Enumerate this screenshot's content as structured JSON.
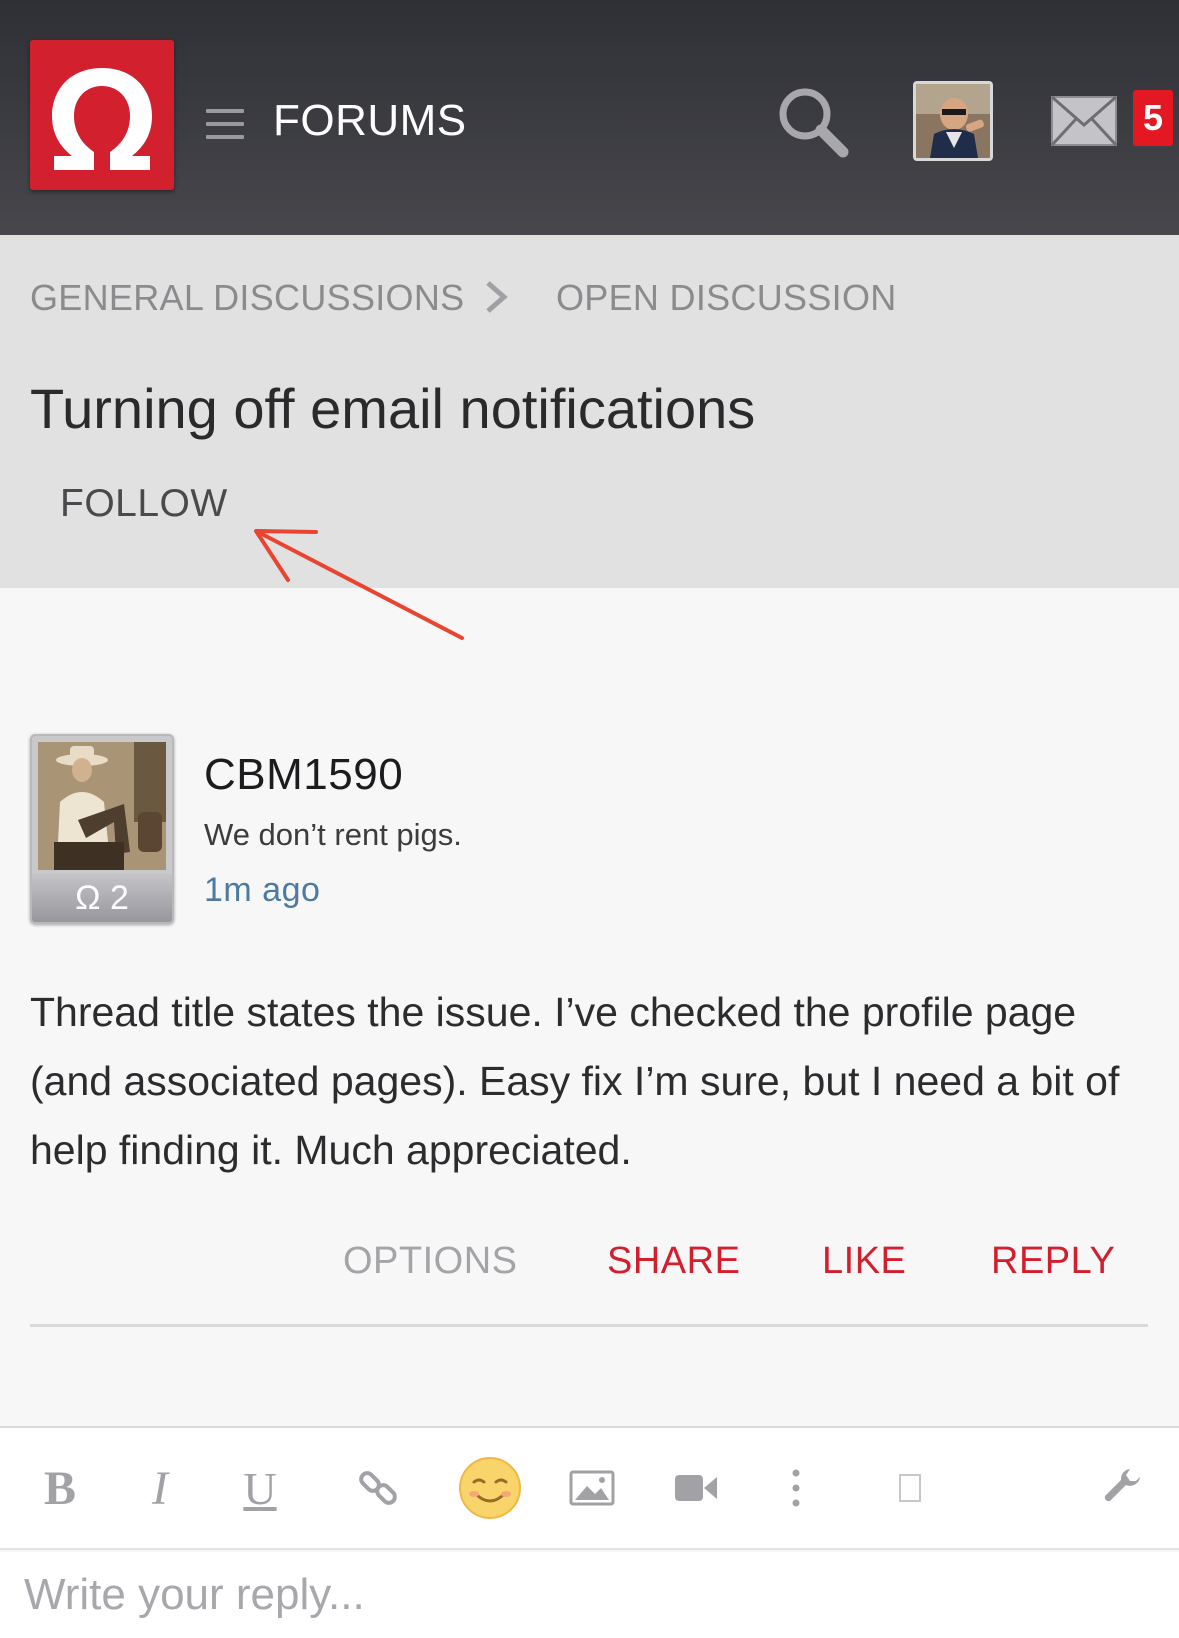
{
  "header": {
    "title": "FORUMS",
    "notification_count": "5",
    "icons": {
      "logo": "omega-logo",
      "menu": "hamburger-icon",
      "search": "search-icon",
      "mail": "mail-icon"
    },
    "colors": {
      "brand": "#d3202f",
      "badge": "#e41822"
    }
  },
  "breadcrumb": {
    "items": [
      "GENERAL DISCUSSIONS",
      "OPEN DISCUSSION"
    ]
  },
  "thread": {
    "title": "Turning off email notifications",
    "follow_label": "FOLLOW"
  },
  "post": {
    "author": "CBM1590",
    "tagline": "We don’t rent pigs.",
    "time": "1m ago",
    "rank": "Ω 2",
    "body": "Thread title states the issue. I’ve checked the profile page (and associated pages). Easy fix I’m sure, but I need a bit of help finding it. Much appreciated.",
    "actions": {
      "options": "OPTIONS",
      "share": "SHARE",
      "like": "LIKE",
      "reply": "REPLY"
    },
    "colors": {
      "action": "#d21f2d",
      "time": "#4d7aa1"
    }
  },
  "editor": {
    "toolbar": {
      "bold": "B",
      "italic": "I",
      "underline": "U"
    },
    "placeholder": "Write your reply..."
  }
}
